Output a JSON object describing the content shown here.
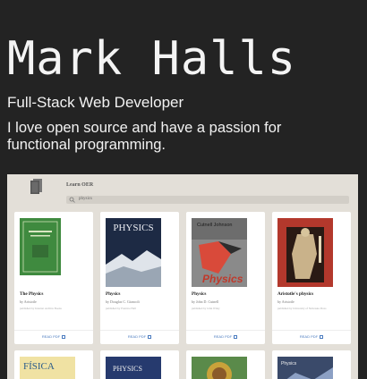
{
  "profile": {
    "name": "Mark Halls",
    "role": "Full-Stack Web Developer",
    "bio": "I love open source and have a passion for functional programming."
  },
  "screenshot": {
    "app_title": "Learn OER",
    "search": {
      "value": "physics",
      "icon": "search-icon"
    },
    "books": [
      {
        "title": "The Physics",
        "author": "by Aristotle",
        "publisher": "published by Internet Archive Books",
        "action": "READ PDF",
        "cover_color": "#3f8a3f"
      },
      {
        "title": "Physics",
        "author": "by Douglas C. Giancoli",
        "publisher": "published by Prentice Hall",
        "action": "READ PDF",
        "cover_color": "#1d2a44",
        "cover_text": "PHYSICS"
      },
      {
        "title": "Physics",
        "author": "by John D. Cutnell",
        "publisher": "published by John Wiley",
        "action": "READ PDF",
        "cover_color": "#8a8a8a",
        "cover_text": "Physics",
        "cover_authors": "Cutnell Johnson"
      },
      {
        "title": "Aristotle's physics",
        "author": "by Aristotle",
        "publisher": "published by University of Nebraska Press",
        "action": "READ PDF",
        "cover_color": "#b3382c"
      }
    ],
    "row2_books": [
      {
        "cover_text": "FÍSICA",
        "cover_color": "#f0e2a3"
      },
      {
        "cover_text": "PHYSICS",
        "cover_color": "#263a6e"
      },
      {
        "cover_text": "",
        "cover_color": "#5a8a4a"
      },
      {
        "cover_text": "Physics",
        "cover_color": "#3a4a6a"
      }
    ]
  }
}
